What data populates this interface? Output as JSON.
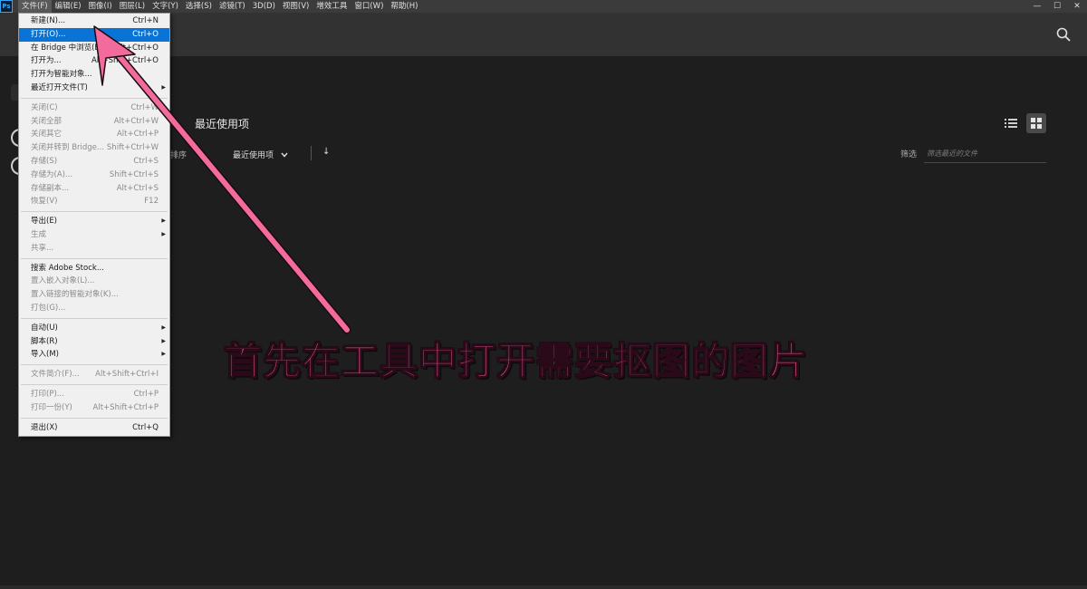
{
  "menubar": {
    "logo": "Ps",
    "items": [
      "文件(F)",
      "编辑(E)",
      "图像(I)",
      "图层(L)",
      "文字(Y)",
      "选择(S)",
      "滤镜(T)",
      "3D(D)",
      "视图(V)",
      "增效工具",
      "窗口(W)",
      "帮助(H)"
    ],
    "window_controls": {
      "minimize": "—",
      "maximize": "☐",
      "close": "✕"
    }
  },
  "file_menu": {
    "groups": [
      [
        {
          "label": "新建(N)...",
          "shortcut": "Ctrl+N"
        },
        {
          "label": "打开(O)...",
          "shortcut": "Ctrl+O",
          "highlighted": true
        },
        {
          "label": "在 Bridge 中浏览(B)...",
          "shortcut": "Alt+Ctrl+O"
        },
        {
          "label": "打开为...",
          "shortcut": "Alt+Shift+Ctrl+O"
        },
        {
          "label": "打开为智能对象...",
          "shortcut": ""
        },
        {
          "label": "最近打开文件(T)",
          "shortcut": "",
          "submenu": true
        }
      ],
      [
        {
          "label": "关闭(C)",
          "shortcut": "Ctrl+W",
          "disabled": true
        },
        {
          "label": "关闭全部",
          "shortcut": "Alt+Ctrl+W",
          "disabled": true
        },
        {
          "label": "关闭其它",
          "shortcut": "Alt+Ctrl+P",
          "disabled": true
        },
        {
          "label": "关闭并转到 Bridge...",
          "shortcut": "Shift+Ctrl+W",
          "disabled": true
        },
        {
          "label": "存储(S)",
          "shortcut": "Ctrl+S",
          "disabled": true
        },
        {
          "label": "存储为(A)...",
          "shortcut": "Shift+Ctrl+S",
          "disabled": true
        },
        {
          "label": "存储副本...",
          "shortcut": "Alt+Ctrl+S",
          "disabled": true
        },
        {
          "label": "恢复(V)",
          "shortcut": "F12",
          "disabled": true
        }
      ],
      [
        {
          "label": "导出(E)",
          "shortcut": "",
          "submenu": true
        },
        {
          "label": "生成",
          "shortcut": "",
          "submenu": true,
          "disabled": true
        },
        {
          "label": "共享...",
          "shortcut": "",
          "disabled": true
        }
      ],
      [
        {
          "label": "搜索 Adobe Stock...",
          "shortcut": ""
        },
        {
          "label": "置入嵌入对象(L)...",
          "shortcut": "",
          "disabled": true
        },
        {
          "label": "置入链接的智能对象(K)...",
          "shortcut": "",
          "disabled": true
        },
        {
          "label": "打包(G)...",
          "shortcut": "",
          "disabled": true
        }
      ],
      [
        {
          "label": "自动(U)",
          "shortcut": "",
          "submenu": true
        },
        {
          "label": "脚本(R)",
          "shortcut": "",
          "submenu": true
        },
        {
          "label": "导入(M)",
          "shortcut": "",
          "submenu": true
        }
      ],
      [
        {
          "label": "文件简介(F)...",
          "shortcut": "Alt+Shift+Ctrl+I",
          "disabled": true
        }
      ],
      [
        {
          "label": "打印(P)...",
          "shortcut": "Ctrl+P",
          "disabled": true
        },
        {
          "label": "打印一份(Y)",
          "shortcut": "Alt+Shift+Ctrl+P",
          "disabled": true
        }
      ],
      [
        {
          "label": "退出(X)",
          "shortcut": "Ctrl+Q"
        }
      ]
    ]
  },
  "home": {
    "recent_title": "最近使用项",
    "sort_label": "排序",
    "sort_value": "最近使用项",
    "sort_direction": "↓",
    "filter_label": "筛选",
    "filter_placeholder": "筛选最近的文件"
  },
  "annotation": {
    "caption": "首先在工具中打开需要抠图的图片",
    "color": "#f8669d"
  },
  "colors": {
    "background": "#1e1e1e",
    "menubar": "#3b3b3b",
    "header": "#323232",
    "menu_highlight": "#0a74d6"
  }
}
